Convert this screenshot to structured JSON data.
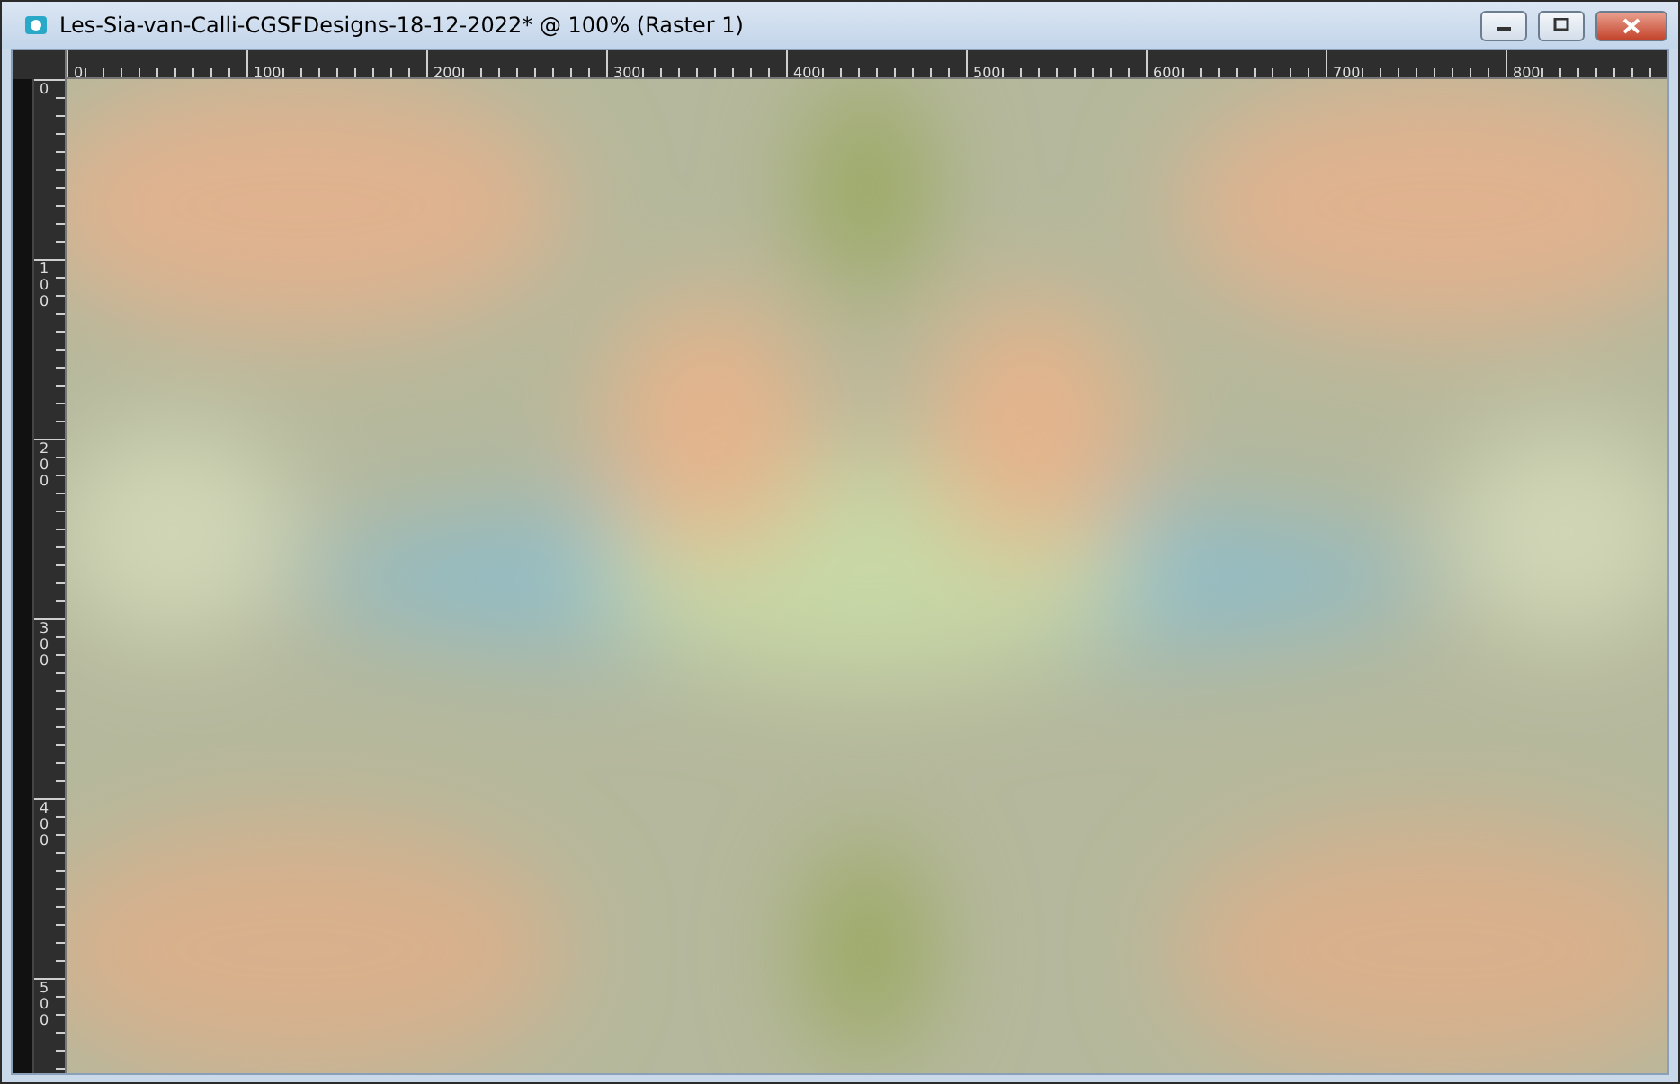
{
  "window": {
    "title": "Les-Sia-van-Calli-CGSFDesigns-18-12-2022* @ 100% (Raster 1)"
  },
  "rulers": {
    "horizontal": [
      "0",
      "100",
      "200",
      "300",
      "400",
      "500",
      "600",
      "700",
      "800"
    ],
    "vertical": [
      "0",
      "100",
      "200",
      "300",
      "400",
      "500"
    ]
  }
}
